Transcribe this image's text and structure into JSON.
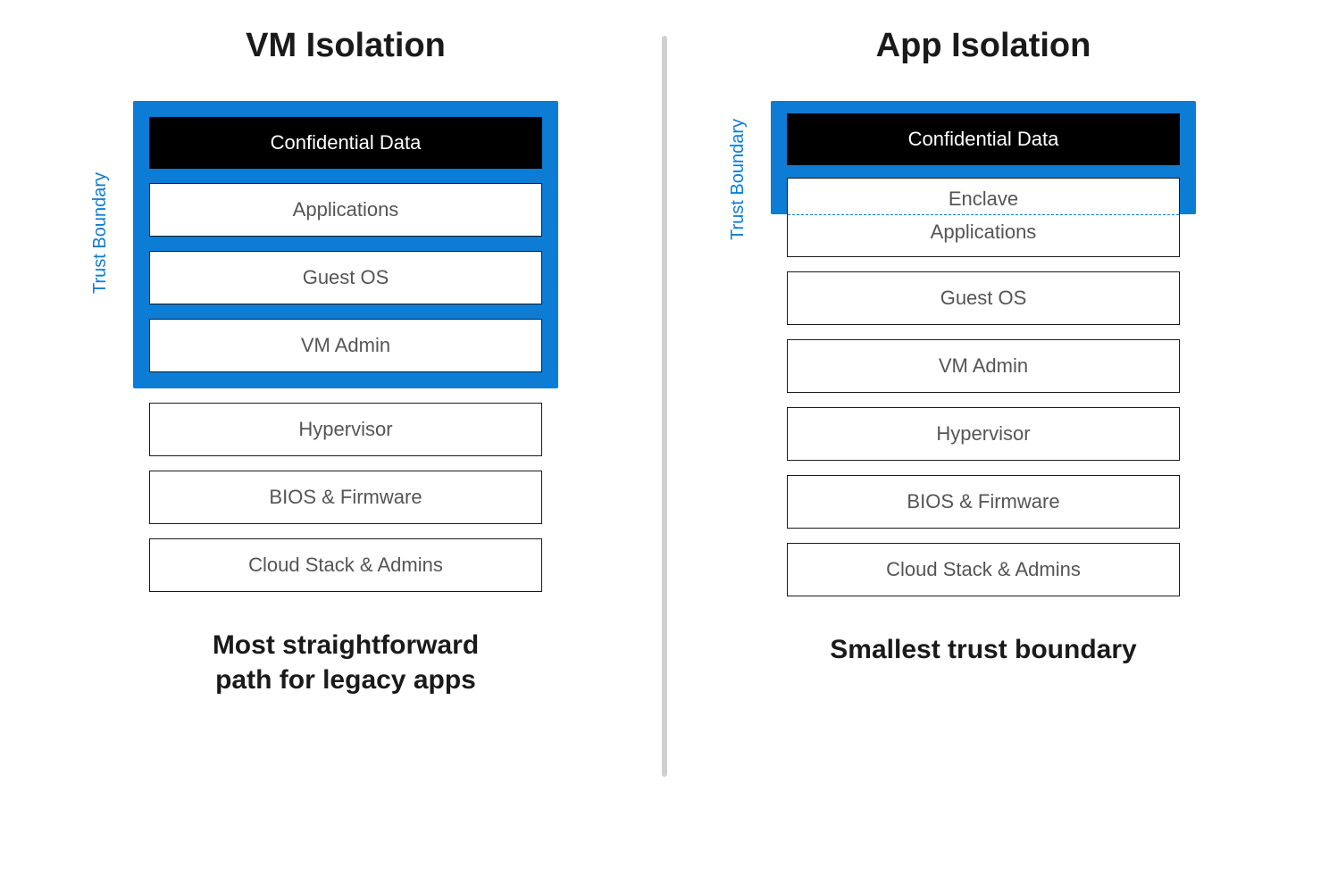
{
  "left": {
    "title": "VM Isolation",
    "caption_line1": "Most straightforward",
    "caption_line2": "path for legacy apps",
    "trust_label": "Trust Boundary",
    "trust_layers": [
      "Confidential Data",
      "Applications",
      "Guest OS",
      "VM Admin"
    ],
    "outer_layers": [
      "Hypervisor",
      "BIOS & Firmware",
      "Cloud Stack & Admins"
    ]
  },
  "right": {
    "title": "App Isolation",
    "caption": "Smallest trust boundary",
    "trust_label": "Trust Boundary",
    "trust_layers": {
      "confidential": "Confidential Data",
      "enclave": "Enclave"
    },
    "applications": "Applications",
    "outer_layers": [
      "Guest OS",
      "VM Admin",
      "Hypervisor",
      "BIOS & Firmware",
      "Cloud Stack & Admins"
    ]
  }
}
